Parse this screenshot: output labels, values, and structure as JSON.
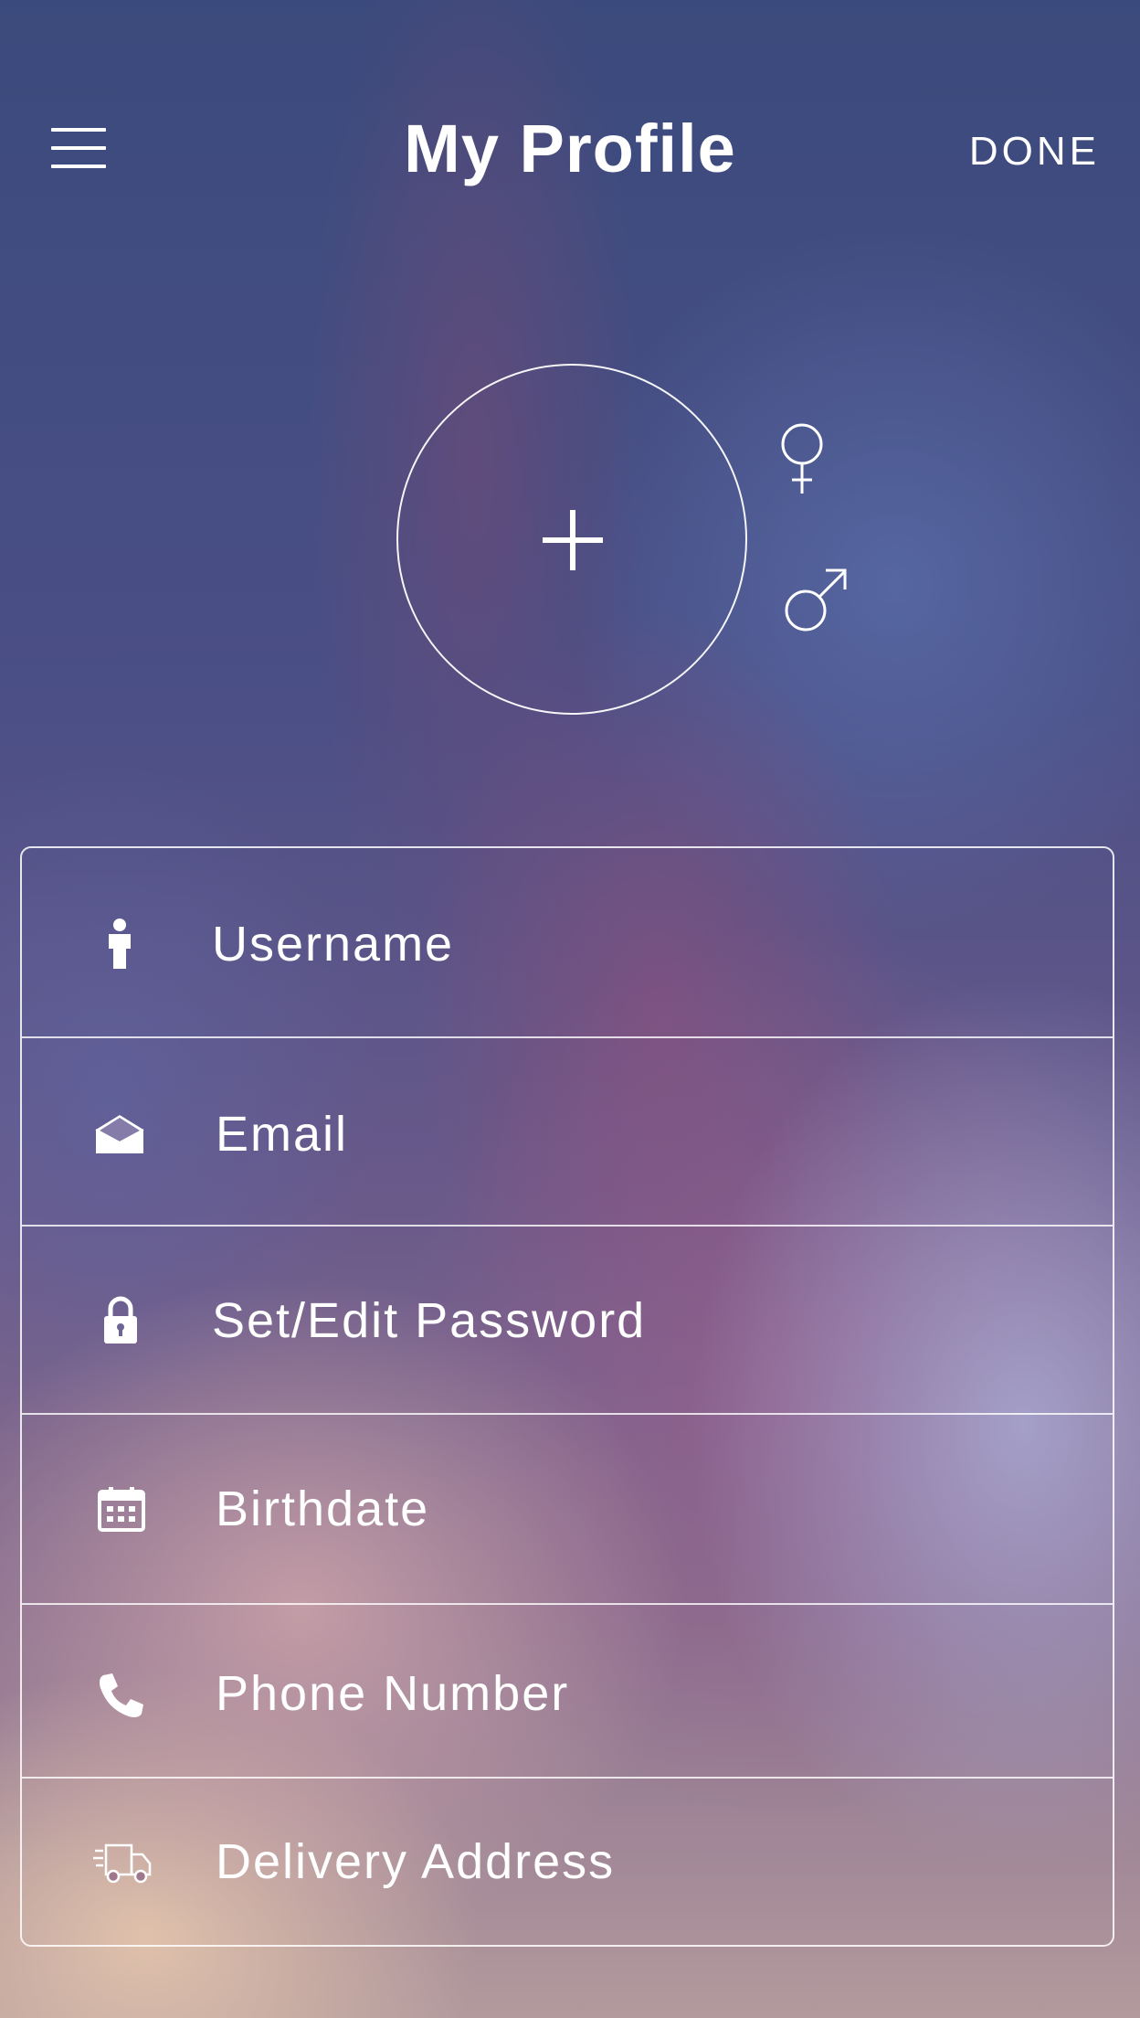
{
  "header": {
    "title": "My Profile",
    "done_label": "DONE",
    "menu_icon": "hamburger-menu-icon"
  },
  "avatar": {
    "add_icon": "plus-icon",
    "gender_options": [
      "female-symbol-icon",
      "male-symbol-icon"
    ]
  },
  "form": {
    "rows": [
      {
        "label": "Username",
        "icon": "person-icon"
      },
      {
        "label": "Email",
        "icon": "envelope-open-icon"
      },
      {
        "label": "Set/Edit Password",
        "icon": "lock-icon"
      },
      {
        "label": "Birthdate",
        "icon": "calendar-icon"
      },
      {
        "label": "Phone Number",
        "icon": "phone-icon"
      },
      {
        "label": "Delivery Address",
        "icon": "delivery-truck-icon"
      }
    ]
  },
  "colors": {
    "text": "#ffffff",
    "border": "#ffffff"
  }
}
